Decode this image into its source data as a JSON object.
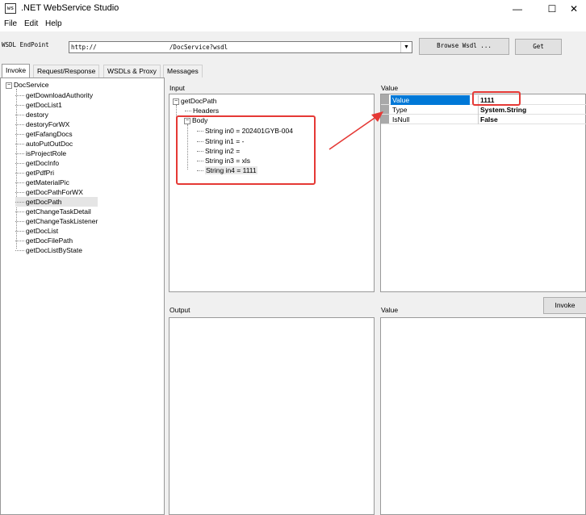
{
  "window": {
    "title": ".NET WebService Studio",
    "icon_text": "ws",
    "minimize": "—",
    "maximize": "☐",
    "close": "✕"
  },
  "menu": [
    "File",
    "Edit",
    "Help"
  ],
  "wsdl": {
    "label": "WSDL EndPoint",
    "value": "http://                    /DocService?wsdl",
    "browse_label": "Browse Wsdl ...",
    "get_label": "Get"
  },
  "tabs": [
    "Invoke",
    "Request/Response",
    "WSDLs & Proxy",
    "Messages"
  ],
  "service_tree": {
    "root": "DocService",
    "items": [
      "getDownloadAuthority",
      "getDocList1",
      "destory",
      "destoryForWX",
      "getFafangDocs",
      "autoPutOutDoc",
      "isProjectRole",
      "getDocInfo",
      "getPdfPri",
      "getMaterialPic",
      "getDocPathForWX",
      "getDocPath",
      "getChangeTaskDetail",
      "getChangeTaskListener",
      "getDocList",
      "getDocFilePath",
      "getDocListByState"
    ],
    "selected": "getDocPath"
  },
  "input": {
    "label": "Input",
    "root": "getDocPath",
    "headers": "Headers",
    "body": "Body",
    "params": [
      "String in0 = 202401GYB-004",
      "String in1 = -",
      "String in2 =",
      "String in3 = xls",
      "String in4 = 1111"
    ]
  },
  "value_panel": {
    "label": "Value",
    "rows": [
      {
        "name": "Value",
        "value": "1111"
      },
      {
        "name": "Type",
        "value": "System.String"
      },
      {
        "name": "IsNull",
        "value": "False"
      }
    ]
  },
  "output": {
    "label": "Output"
  },
  "output_value": {
    "label": "Value"
  },
  "invoke_label": "Invoke",
  "colors": {
    "selection": "#0078d7",
    "annotation": "#e53935"
  }
}
